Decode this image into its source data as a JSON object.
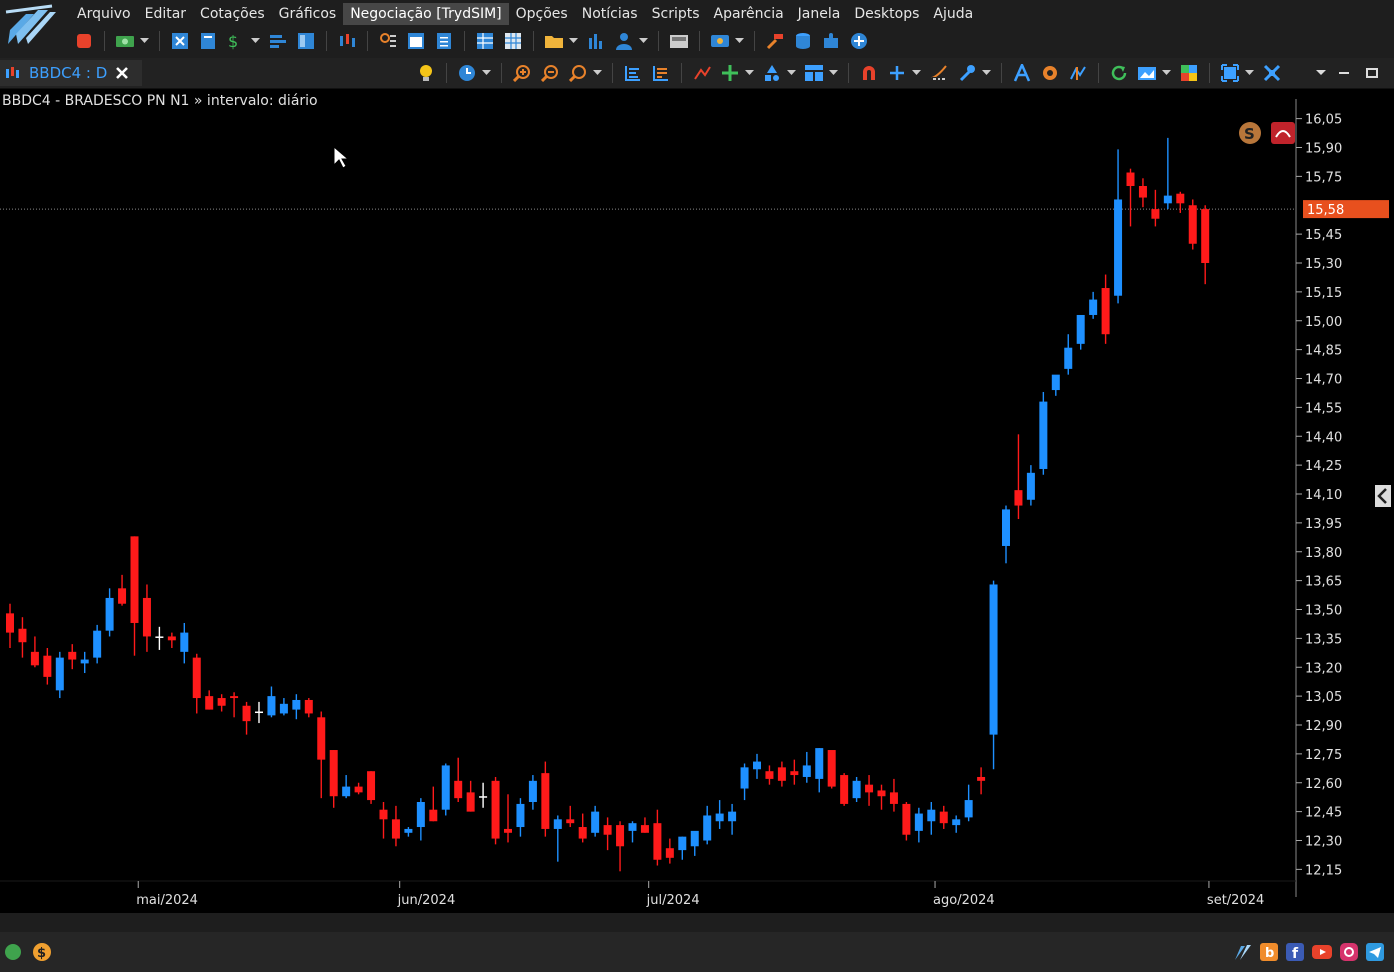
{
  "menu": [
    {
      "name": "menu-arquivo",
      "label": "Arquivo"
    },
    {
      "name": "menu-editar",
      "label": "Editar"
    },
    {
      "name": "menu-cotacoes",
      "label": "Cotações"
    },
    {
      "name": "menu-graficos",
      "label": "Gráficos"
    },
    {
      "name": "menu-negociacao",
      "label": "Negociação [TrydSIM]",
      "active": true
    },
    {
      "name": "menu-opcoes",
      "label": "Opções"
    },
    {
      "name": "menu-noticias",
      "label": "Notícias"
    },
    {
      "name": "menu-scripts",
      "label": "Scripts"
    },
    {
      "name": "menu-aparencia",
      "label": "Aparência"
    },
    {
      "name": "menu-janela",
      "label": "Janela"
    },
    {
      "name": "menu-desktops",
      "label": "Desktops"
    },
    {
      "name": "menu-ajuda",
      "label": "Ajuda"
    }
  ],
  "tab": {
    "label": "BBDC4 : D"
  },
  "chart": {
    "title": "BBDC4 - BRADESCO PN N1 » intervalo: diário",
    "last_price_label": "15,58"
  },
  "colors": {
    "up": "#1e90ff",
    "down": "#ff1a1a",
    "neutral": "#ffffff",
    "price_tag": "#e8501e",
    "accent": "#3da0ff"
  },
  "chart_data": {
    "type": "candlestick",
    "title": "BBDC4 - BRADESCO PN N1 » intervalo: diário",
    "y_ticks": [
      "16,05",
      "15,90",
      "15,75",
      "15,45",
      "15,30",
      "15,15",
      "15,00",
      "14,85",
      "14,70",
      "14,55",
      "14,40",
      "14,25",
      "14,10",
      "13,95",
      "13,80",
      "13,65",
      "13,50",
      "13,35",
      "13,20",
      "13,05",
      "12,90",
      "12,75",
      "12,60",
      "12,45",
      "12,30",
      "12,15"
    ],
    "y_tick_values": [
      16.05,
      15.9,
      15.75,
      15.45,
      15.3,
      15.15,
      15.0,
      14.85,
      14.7,
      14.55,
      14.4,
      14.25,
      14.1,
      13.95,
      13.8,
      13.65,
      13.5,
      13.35,
      13.2,
      13.05,
      12.9,
      12.75,
      12.6,
      12.45,
      12.3,
      12.15
    ],
    "ylim": [
      12.1,
      16.1
    ],
    "last_price": 15.58,
    "x_labels": [
      {
        "label": "mai/2024",
        "index": 10.3
      },
      {
        "label": "jun/2024",
        "index": 31.3
      },
      {
        "label": "jul/2024",
        "index": 51.3
      },
      {
        "label": "ago/2024",
        "index": 74.3
      },
      {
        "label": "set/2024",
        "index": 96.3
      }
    ],
    "candles": [
      {
        "o": 13.48,
        "h": 13.53,
        "l": 13.3,
        "c": 13.38
      },
      {
        "o": 13.4,
        "h": 13.46,
        "l": 13.25,
        "c": 13.33
      },
      {
        "o": 13.28,
        "h": 13.36,
        "l": 13.2,
        "c": 13.21
      },
      {
        "o": 13.26,
        "h": 13.3,
        "l": 13.11,
        "c": 13.15
      },
      {
        "o": 13.08,
        "h": 13.28,
        "l": 13.04,
        "c": 13.25
      },
      {
        "o": 13.28,
        "h": 13.32,
        "l": 13.19,
        "c": 13.24
      },
      {
        "o": 13.22,
        "h": 13.28,
        "l": 13.17,
        "c": 13.24
      },
      {
        "o": 13.25,
        "h": 13.42,
        "l": 13.22,
        "c": 13.39
      },
      {
        "o": 13.39,
        "h": 13.61,
        "l": 13.36,
        "c": 13.56
      },
      {
        "o": 13.61,
        "h": 13.68,
        "l": 13.52,
        "c": 13.53
      },
      {
        "o": 13.88,
        "h": 13.88,
        "l": 13.26,
        "c": 13.43
      },
      {
        "o": 13.56,
        "h": 13.63,
        "l": 13.28,
        "c": 13.36
      },
      {
        "o": 13.36,
        "h": 13.41,
        "l": 13.29,
        "c": 13.36
      },
      {
        "o": 13.36,
        "h": 13.38,
        "l": 13.3,
        "c": 13.34
      },
      {
        "o": 13.28,
        "h": 13.43,
        "l": 13.22,
        "c": 13.38
      },
      {
        "o": 13.25,
        "h": 13.27,
        "l": 12.96,
        "c": 13.04
      },
      {
        "o": 13.05,
        "h": 13.08,
        "l": 12.98,
        "c": 12.98
      },
      {
        "o": 13.04,
        "h": 13.06,
        "l": 12.97,
        "c": 13.0
      },
      {
        "o": 13.05,
        "h": 13.07,
        "l": 12.94,
        "c": 13.04
      },
      {
        "o": 13.0,
        "h": 13.02,
        "l": 12.85,
        "c": 12.92
      },
      {
        "o": 12.97,
        "h": 13.02,
        "l": 12.91,
        "c": 12.97
      },
      {
        "o": 12.95,
        "h": 13.1,
        "l": 12.94,
        "c": 13.05
      },
      {
        "o": 12.96,
        "h": 13.04,
        "l": 12.95,
        "c": 13.01
      },
      {
        "o": 12.98,
        "h": 13.06,
        "l": 12.93,
        "c": 13.03
      },
      {
        "o": 13.03,
        "h": 13.04,
        "l": 12.94,
        "c": 12.96
      },
      {
        "o": 12.94,
        "h": 12.97,
        "l": 12.52,
        "c": 12.72
      },
      {
        "o": 12.77,
        "h": 12.77,
        "l": 12.47,
        "c": 12.53
      },
      {
        "o": 12.53,
        "h": 12.64,
        "l": 12.52,
        "c": 12.58
      },
      {
        "o": 12.58,
        "h": 12.6,
        "l": 12.54,
        "c": 12.55
      },
      {
        "o": 12.66,
        "h": 12.66,
        "l": 12.49,
        "c": 12.51
      },
      {
        "o": 12.46,
        "h": 12.5,
        "l": 12.31,
        "c": 12.41
      },
      {
        "o": 12.41,
        "h": 12.48,
        "l": 12.27,
        "c": 12.31
      },
      {
        "o": 12.34,
        "h": 12.37,
        "l": 12.32,
        "c": 12.36
      },
      {
        "o": 12.37,
        "h": 12.52,
        "l": 12.3,
        "c": 12.5
      },
      {
        "o": 12.46,
        "h": 12.58,
        "l": 12.4,
        "c": 12.4
      },
      {
        "o": 12.46,
        "h": 12.7,
        "l": 12.43,
        "c": 12.69
      },
      {
        "o": 12.61,
        "h": 12.73,
        "l": 12.5,
        "c": 12.52
      },
      {
        "o": 12.55,
        "h": 12.61,
        "l": 12.45,
        "c": 12.45
      },
      {
        "o": 12.53,
        "h": 12.6,
        "l": 12.47,
        "c": 12.53
      },
      {
        "o": 12.61,
        "h": 12.63,
        "l": 12.28,
        "c": 12.31
      },
      {
        "o": 12.36,
        "h": 12.54,
        "l": 12.29,
        "c": 12.34
      },
      {
        "o": 12.37,
        "h": 12.52,
        "l": 12.32,
        "c": 12.49
      },
      {
        "o": 12.5,
        "h": 12.64,
        "l": 12.46,
        "c": 12.61
      },
      {
        "o": 12.65,
        "h": 12.71,
        "l": 12.32,
        "c": 12.36
      },
      {
        "o": 12.36,
        "h": 12.43,
        "l": 12.19,
        "c": 12.41
      },
      {
        "o": 12.41,
        "h": 12.48,
        "l": 12.37,
        "c": 12.39
      },
      {
        "o": 12.37,
        "h": 12.44,
        "l": 12.29,
        "c": 12.31
      },
      {
        "o": 12.34,
        "h": 12.48,
        "l": 12.32,
        "c": 12.45
      },
      {
        "o": 12.38,
        "h": 12.42,
        "l": 12.25,
        "c": 12.33
      },
      {
        "o": 12.38,
        "h": 12.4,
        "l": 12.14,
        "c": 12.27
      },
      {
        "o": 12.35,
        "h": 12.4,
        "l": 12.29,
        "c": 12.39
      },
      {
        "o": 12.38,
        "h": 12.42,
        "l": 12.34,
        "c": 12.34
      },
      {
        "o": 12.39,
        "h": 12.46,
        "l": 12.17,
        "c": 12.2
      },
      {
        "o": 12.26,
        "h": 12.31,
        "l": 12.18,
        "c": 12.21
      },
      {
        "o": 12.25,
        "h": 12.32,
        "l": 12.2,
        "c": 12.32
      },
      {
        "o": 12.27,
        "h": 12.34,
        "l": 12.22,
        "c": 12.35
      },
      {
        "o": 12.3,
        "h": 12.48,
        "l": 12.28,
        "c": 12.43
      },
      {
        "o": 12.4,
        "h": 12.51,
        "l": 12.36,
        "c": 12.44
      },
      {
        "o": 12.4,
        "h": 12.49,
        "l": 12.33,
        "c": 12.45
      },
      {
        "o": 12.57,
        "h": 12.7,
        "l": 12.51,
        "c": 12.68
      },
      {
        "o": 12.67,
        "h": 12.75,
        "l": 12.62,
        "c": 12.71
      },
      {
        "o": 12.66,
        "h": 12.69,
        "l": 12.59,
        "c": 12.62
      },
      {
        "o": 12.68,
        "h": 12.71,
        "l": 12.58,
        "c": 12.61
      },
      {
        "o": 12.66,
        "h": 12.72,
        "l": 12.59,
        "c": 12.64
      },
      {
        "o": 12.63,
        "h": 12.76,
        "l": 12.6,
        "c": 12.69
      },
      {
        "o": 12.62,
        "h": 12.78,
        "l": 12.55,
        "c": 12.78
      },
      {
        "o": 12.77,
        "h": 12.72,
        "l": 12.57,
        "c": 12.58
      },
      {
        "o": 12.64,
        "h": 12.65,
        "l": 12.48,
        "c": 12.49
      },
      {
        "o": 12.52,
        "h": 12.63,
        "l": 12.5,
        "c": 12.61
      },
      {
        "o": 12.59,
        "h": 12.64,
        "l": 12.48,
        "c": 12.55
      },
      {
        "o": 12.56,
        "h": 12.59,
        "l": 12.46,
        "c": 12.53
      },
      {
        "o": 12.55,
        "h": 12.62,
        "l": 12.45,
        "c": 12.49
      },
      {
        "o": 12.49,
        "h": 12.5,
        "l": 12.3,
        "c": 12.33
      },
      {
        "o": 12.35,
        "h": 12.47,
        "l": 12.29,
        "c": 12.44
      },
      {
        "o": 12.4,
        "h": 12.5,
        "l": 12.33,
        "c": 12.46
      },
      {
        "o": 12.45,
        "h": 12.48,
        "l": 12.36,
        "c": 12.39
      },
      {
        "o": 12.38,
        "h": 12.43,
        "l": 12.34,
        "c": 12.41
      },
      {
        "o": 12.42,
        "h": 12.59,
        "l": 12.4,
        "c": 12.51
      },
      {
        "o": 12.63,
        "h": 12.68,
        "l": 12.54,
        "c": 12.61
      },
      {
        "o": 12.85,
        "h": 13.65,
        "l": 12.67,
        "c": 13.63
      },
      {
        "o": 13.83,
        "h": 14.04,
        "l": 13.74,
        "c": 14.02
      },
      {
        "o": 14.12,
        "h": 14.41,
        "l": 13.97,
        "c": 14.04
      },
      {
        "o": 14.07,
        "h": 14.25,
        "l": 14.04,
        "c": 14.21
      },
      {
        "o": 14.23,
        "h": 14.63,
        "l": 14.2,
        "c": 14.58
      },
      {
        "o": 14.64,
        "h": 14.7,
        "l": 14.61,
        "c": 14.72
      },
      {
        "o": 14.75,
        "h": 14.93,
        "l": 14.72,
        "c": 14.86
      },
      {
        "o": 14.88,
        "h": 15.01,
        "l": 14.85,
        "c": 15.03
      },
      {
        "o": 15.03,
        "h": 15.15,
        "l": 15.01,
        "c": 15.11
      },
      {
        "o": 15.17,
        "h": 15.24,
        "l": 14.88,
        "c": 14.93
      },
      {
        "o": 15.13,
        "h": 15.89,
        "l": 15.09,
        "c": 15.63
      },
      {
        "o": 15.77,
        "h": 15.79,
        "l": 15.49,
        "c": 15.7
      },
      {
        "o": 15.7,
        "h": 15.74,
        "l": 15.59,
        "c": 15.64
      },
      {
        "o": 15.58,
        "h": 15.68,
        "l": 15.49,
        "c": 15.53
      },
      {
        "o": 15.61,
        "h": 15.95,
        "l": 15.58,
        "c": 15.65
      },
      {
        "o": 15.66,
        "h": 15.67,
        "l": 15.56,
        "c": 15.61
      },
      {
        "o": 15.6,
        "h": 15.63,
        "l": 15.37,
        "c": 15.4
      },
      {
        "o": 15.58,
        "h": 15.6,
        "l": 15.19,
        "c": 15.3
      }
    ]
  }
}
